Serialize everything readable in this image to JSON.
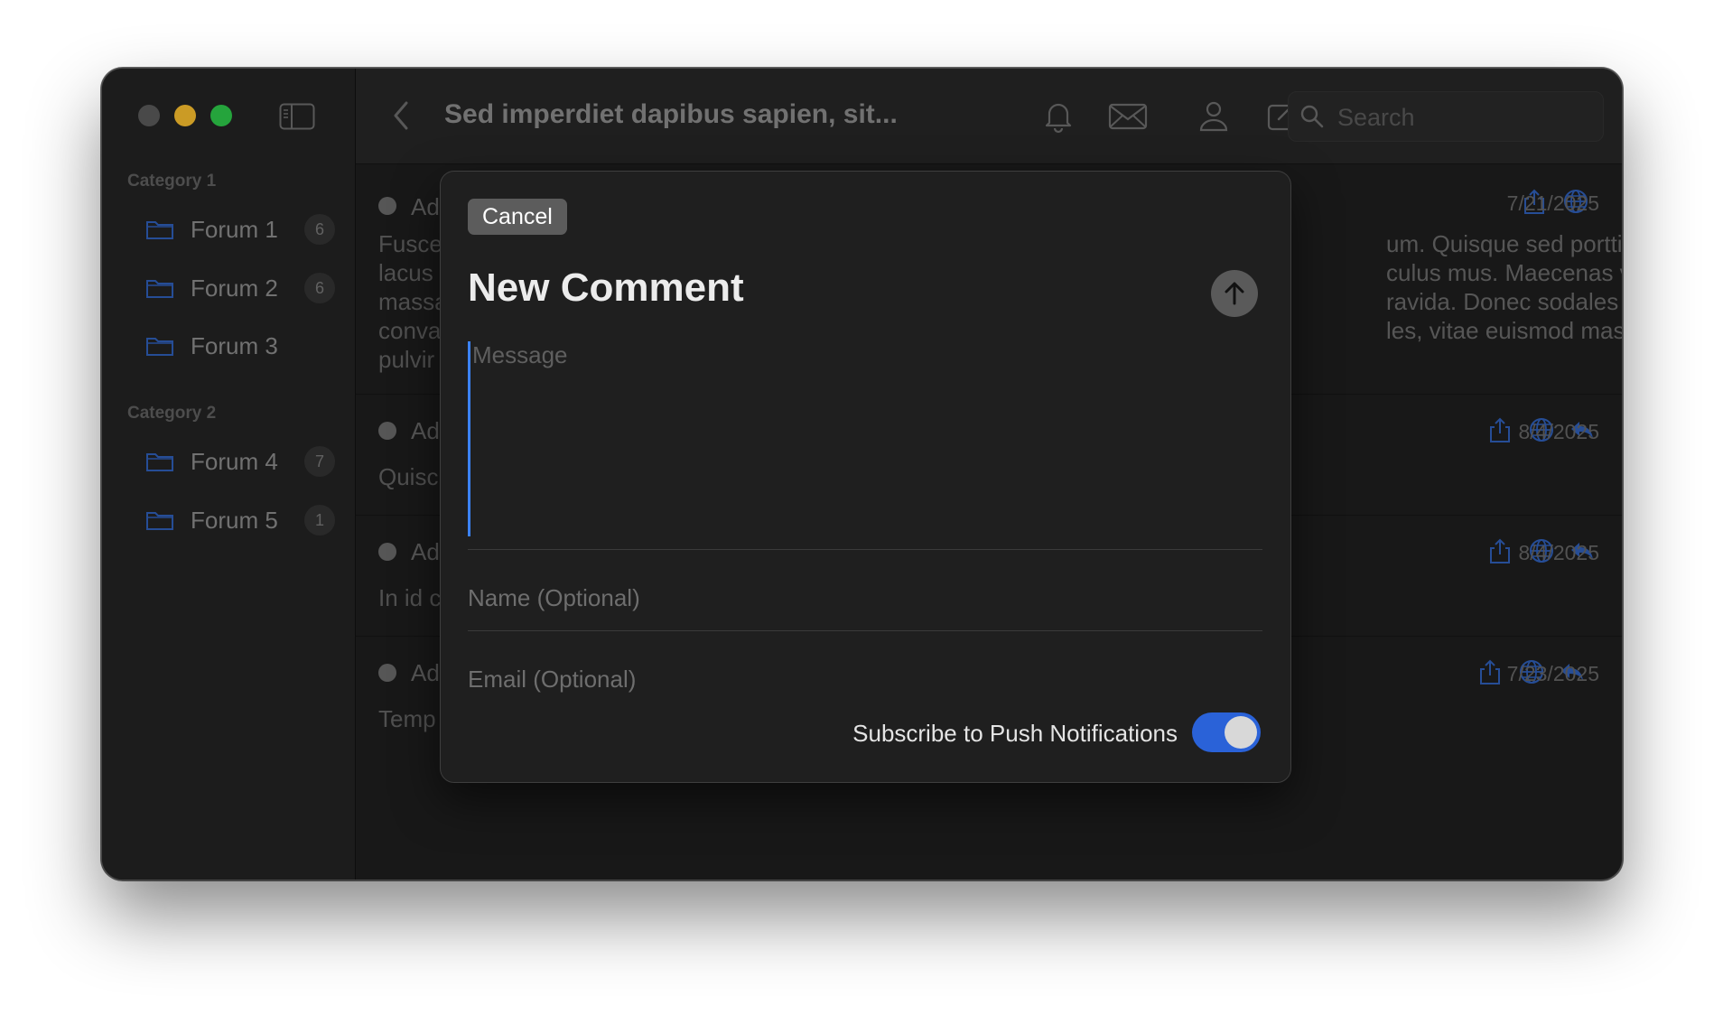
{
  "window": {
    "title": "Sed imperdiet dapibus sapien, sit...",
    "search_placeholder": "Search"
  },
  "sidebar": {
    "categories": [
      {
        "label": "Category 1",
        "forums": [
          {
            "label": "Forum 1",
            "count": "6"
          },
          {
            "label": "Forum 2",
            "count": "6"
          },
          {
            "label": "Forum 3",
            "count": ""
          }
        ]
      },
      {
        "label": "Category 2",
        "forums": [
          {
            "label": "Forum 4",
            "count": "7"
          },
          {
            "label": "Forum 5",
            "count": "1"
          }
        ]
      }
    ]
  },
  "posts": [
    {
      "author": "Ad",
      "date": "7/21/2025",
      "body_left": [
        "Fusce",
        "lacus",
        "massa",
        "conva",
        "pulvir"
      ],
      "body_right": [
        "um. Quisque sed porttitor",
        "culus mus. Maecenas vel",
        "ravida. Donec sodales nisi",
        "les, vitae euismod massa"
      ]
    },
    {
      "author": "Ad",
      "date": "8/4/2025",
      "body_left": [
        "Quisc"
      ],
      "body_right": []
    },
    {
      "author": "Ad",
      "date": "8/4/2025",
      "body_left": [
        "In id c"
      ],
      "body_right": []
    },
    {
      "author": "Ad",
      "date": "7/23/2025",
      "body_left": [
        "Temp"
      ],
      "body_right": []
    }
  ],
  "modal": {
    "cancel_label": "Cancel",
    "title": "New Comment",
    "message_placeholder": "Message",
    "name_placeholder": "Name (Optional)",
    "email_placeholder": "Email (Optional)",
    "subscribe_label": "Subscribe to Push Notifications",
    "subscribe_on": true
  },
  "colors": {
    "accent": "#2a62d8",
    "icon_blue": "#2f5fb8",
    "traffic_min": "#f8bd2e",
    "traffic_max": "#2ec84a"
  },
  "icons": {
    "toolbar": [
      "sidebar-toggle-icon",
      "back-chevron-icon",
      "bell-icon",
      "envelope-icon",
      "person-icon",
      "compose-icon",
      "refresh-icon",
      "search-icon"
    ],
    "post_actions": [
      "share-icon",
      "globe-icon",
      "reply-icon"
    ],
    "send": "arrow-up-icon",
    "folder": "folder-icon"
  }
}
